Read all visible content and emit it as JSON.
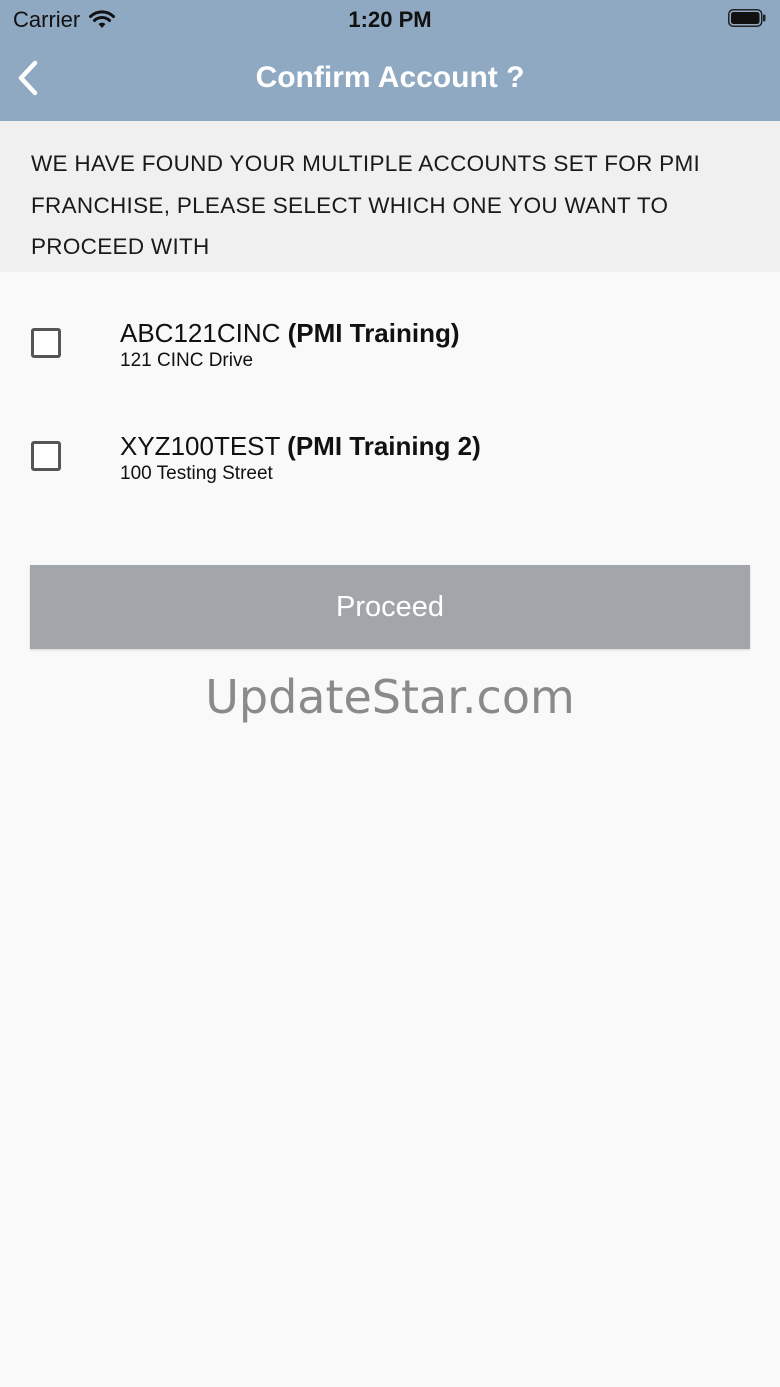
{
  "status_bar": {
    "carrier": "Carrier",
    "time": "1:20 PM"
  },
  "nav": {
    "title": "Confirm Account ?"
  },
  "message": "WE HAVE FOUND YOUR MULTIPLE ACCOUNTS SET FOR PMI FRANCHISE, PLEASE SELECT WHICH ONE YOU WANT TO PROCEED WITH",
  "accounts": [
    {
      "code": "ABC121CINC",
      "name": "(PMI Training)",
      "address": "121 CINC Drive",
      "checked": false
    },
    {
      "code": "XYZ100TEST",
      "name": "(PMI Training 2)",
      "address": "100 Testing Street",
      "checked": false
    }
  ],
  "proceed_label": "Proceed",
  "watermark": "UpdateStar.com",
  "colors": {
    "nav_background": "#8fa9c2",
    "message_background": "#f0f0f0",
    "page_background": "#f9f9f9",
    "button_background": "#a2a6ab"
  },
  "icons": {
    "back": "chevron-left-icon",
    "wifi": "wifi-icon",
    "battery": "battery-icon"
  }
}
